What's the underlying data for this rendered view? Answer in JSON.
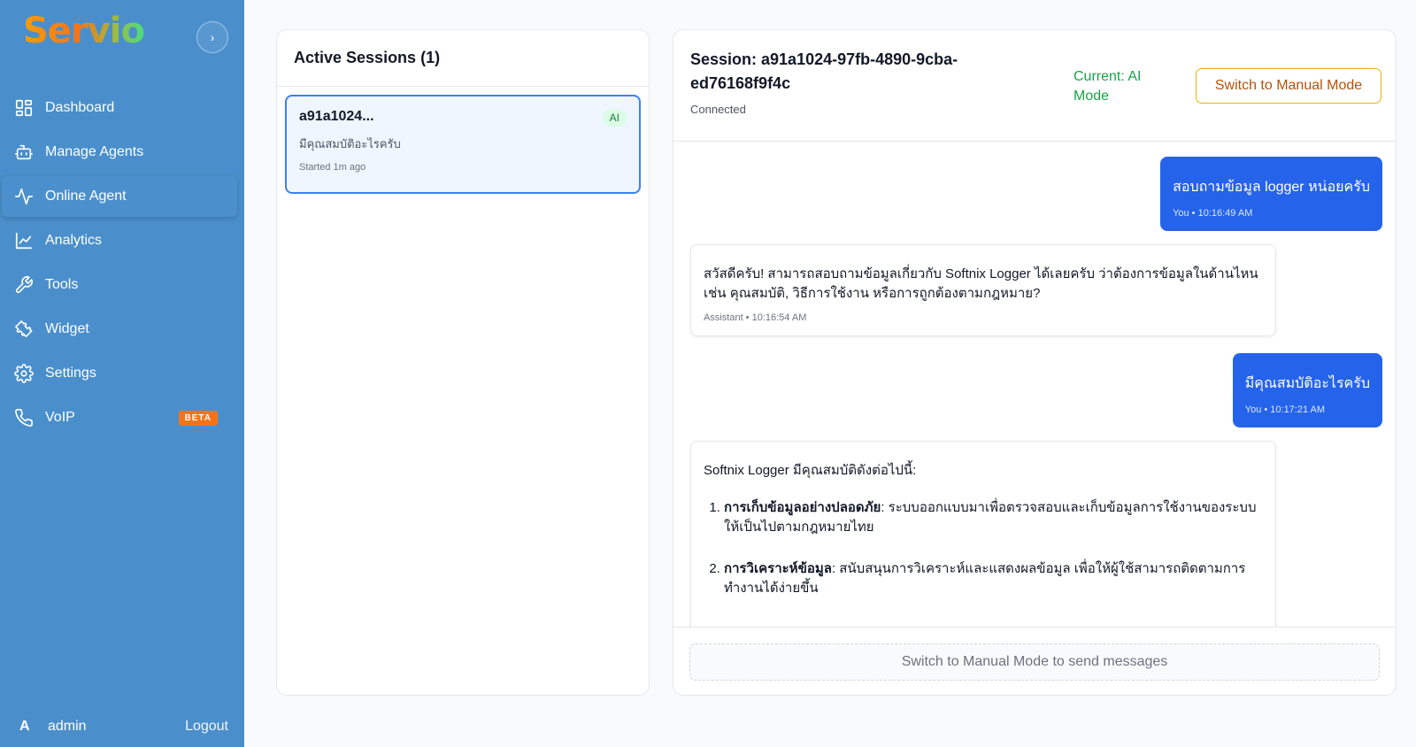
{
  "brand": {
    "logo_text": "Servio"
  },
  "sidebar": {
    "collapse_label": "›",
    "items": [
      {
        "label": "Dashboard",
        "icon": "dashboard-icon"
      },
      {
        "label": "Manage Agents",
        "icon": "bot-icon"
      },
      {
        "label": "Online Agent",
        "icon": "activity-icon",
        "active": true
      },
      {
        "label": "Analytics",
        "icon": "chart-icon"
      },
      {
        "label": "Tools",
        "icon": "wrench-icon"
      },
      {
        "label": "Widget",
        "icon": "puzzle-icon"
      },
      {
        "label": "Settings",
        "icon": "gear-icon"
      },
      {
        "label": "VoIP",
        "icon": "phone-icon",
        "badge": "BETA"
      }
    ],
    "user": {
      "avatar_initial": "A",
      "name": "admin",
      "logout_label": "Logout"
    }
  },
  "sessions": {
    "header": "Active Sessions (1)",
    "items": [
      {
        "id": "a91a1024...",
        "badge": "AI",
        "preview": "มีคุณสมบัติอะไรครับ",
        "started": "Started 1m ago"
      }
    ]
  },
  "chat": {
    "title": "Session: a91a1024-97fb-4890-9cba-ed76168f9f4c",
    "status": "Connected",
    "mode": "Current: AI Mode",
    "switch_label": "Switch to Manual Mode",
    "messages": [
      {
        "role": "user",
        "text": "สอบถามข้อมูล logger หน่อยครับ",
        "meta": "You • 10:16:49 AM"
      },
      {
        "role": "assistant",
        "text": "สวัสดีครับ! สามารถสอบถามข้อมูลเกี่ยวกับ Softnix Logger ได้เลยครับ ว่าต้องการข้อมูลในด้านไหน เช่น คุณสมบัติ, วิธีการใช้งาน หรือการถูกต้องตามกฎหมาย?",
        "meta": "Assistant • 10:16:54 AM"
      },
      {
        "role": "user",
        "text": "มีคุณสมบัติอะไรครับ",
        "meta": "You • 10:17:21 AM"
      },
      {
        "role": "assistant",
        "intro": "Softnix Logger มีคุณสมบัติดังต่อไปนี้:",
        "list": [
          {
            "title": "การเก็บข้อมูลอย่างปลอดภัย",
            "desc": ": ระบบออกแบบมาเพื่อตรวจสอบและเก็บข้อมูลการใช้งานของระบบให้เป็นไปตามกฎหมายไทย"
          },
          {
            "title": "การวิเคราะห์ข้อมูล",
            "desc": ": สนับสนุนการวิเคราะห์และแสดงผลข้อมูล เพื่อให้ผู้ใช้สามารถติดตามการทำงานได้ง่ายขึ้น"
          }
        ]
      }
    ],
    "input_placeholder": "Switch to Manual Mode to send messages"
  },
  "colors": {
    "sidebar_bg": "#4a8fcb",
    "user_bubble": "#2563eb",
    "ai_mode": "#16a34a",
    "switch_border": "#eab308",
    "session_active_border": "#3b82f6",
    "beta_badge": "#f97316"
  }
}
